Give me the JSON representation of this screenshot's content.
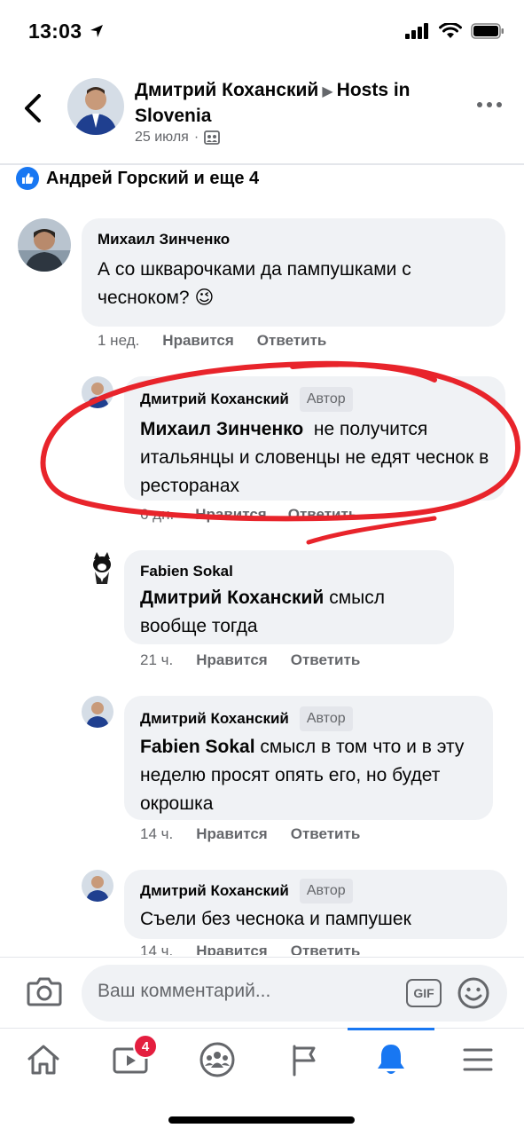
{
  "status": {
    "time": "13:03"
  },
  "header": {
    "author": "Дмитрий Коханский",
    "group": "Hosts in Slovenia",
    "date": "25 июля",
    "separator": "·"
  },
  "reactions": {
    "text": "Андрей Горский и еще 4"
  },
  "comments": [
    {
      "name": "Михаил Зинченко",
      "text": "А со шкварочками да пампушками с чесноком? 😉",
      "age": "1 нед.",
      "like": "Нравится",
      "reply": "Ответить"
    },
    {
      "name": "Дмитрий Коханский",
      "tag": "Автор",
      "mention": "Михаил Зинченко",
      "text": "не получится итальянцы и словенцы не едят чеснок в ресторанах",
      "age": "6 дн.",
      "like": "Нравится",
      "reply": "Ответить"
    },
    {
      "name": "Fabien  Sokal",
      "mention": "Дмитрий Коханский",
      "text": "смысл вообще тогда",
      "age": "21 ч.",
      "like": "Нравится",
      "reply": "Ответить"
    },
    {
      "name": "Дмитрий Коханский",
      "tag": "Автор",
      "mention": "Fabien  Sokal",
      "text": "смысл в том что и в эту неделю просят опять его, но будет окрошка",
      "age": "14 ч.",
      "like": "Нравится",
      "reply": "Ответить"
    },
    {
      "name": "Дмитрий Коханский",
      "tag": "Автор",
      "text": "Съели без чеснока и пампушек",
      "age": "14 ч.",
      "like": "Нравится",
      "reply": "Ответить"
    }
  ],
  "composer": {
    "placeholder": "Ваш комментарий...",
    "gif": "GIF"
  },
  "tabbar": {
    "video_badge": "4",
    "active": "notifications"
  },
  "colors": {
    "accent": "#1877f2",
    "bubble": "#f0f2f5",
    "secondary_text": "#65676b",
    "badge": "#e41e3f",
    "annotation_ink": "#e8242b"
  }
}
